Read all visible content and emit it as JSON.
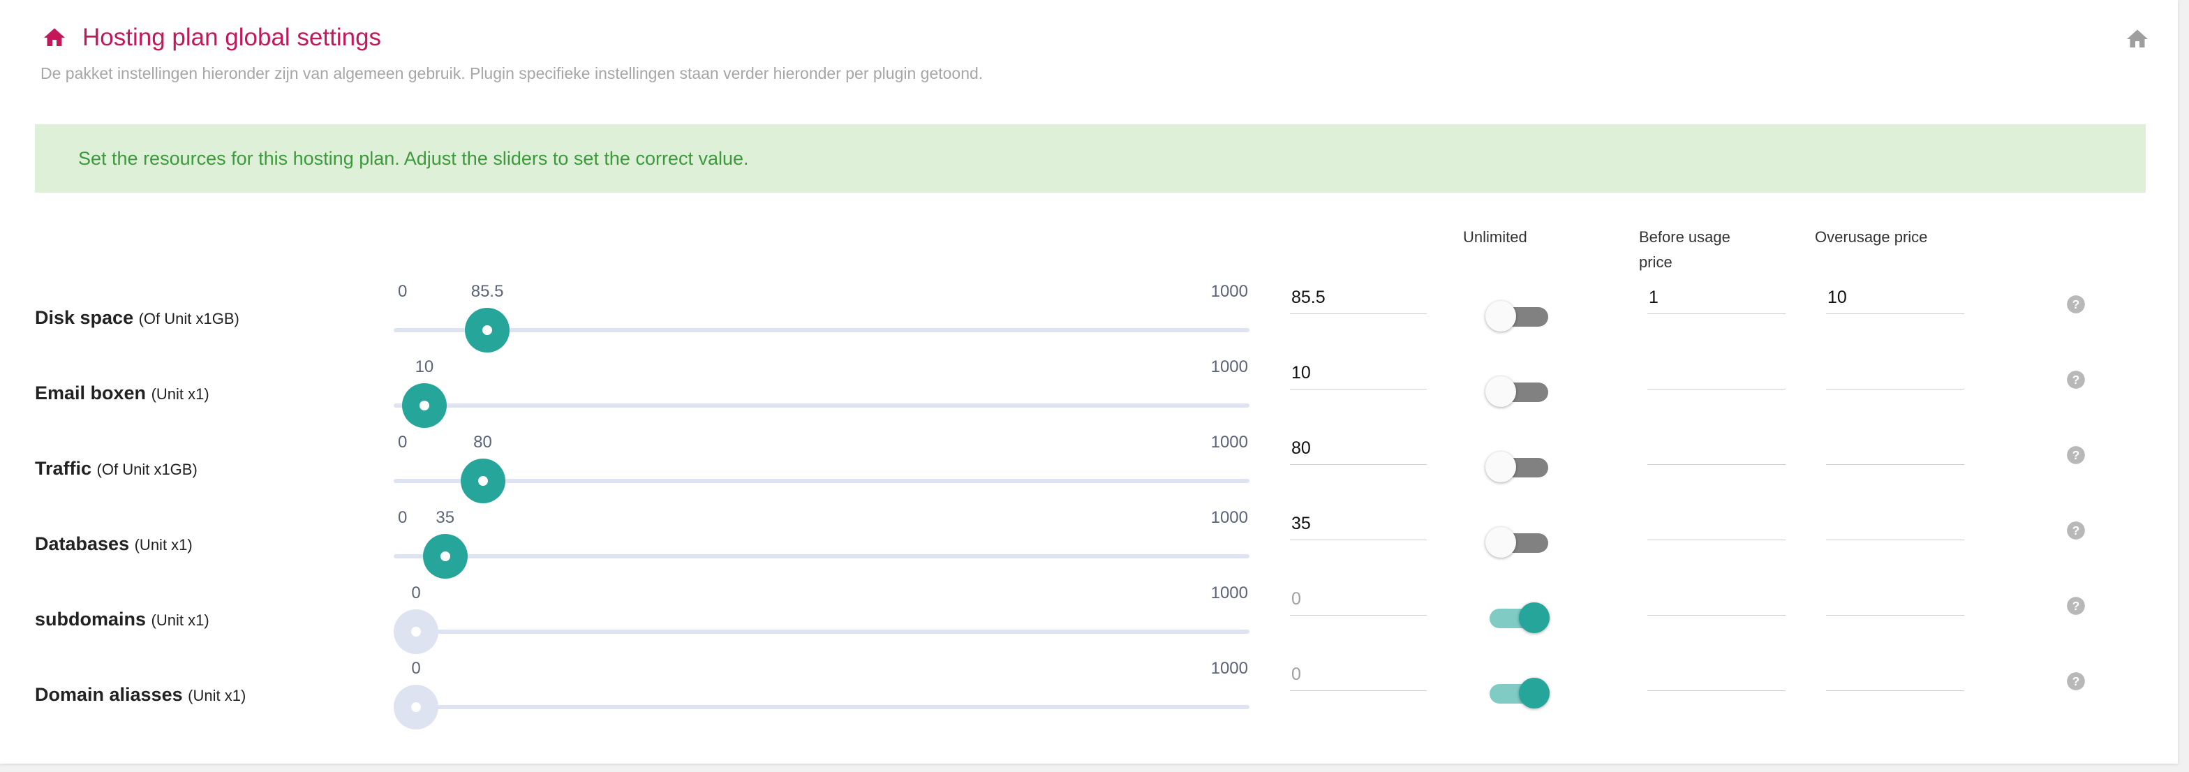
{
  "header": {
    "title": "Hosting plan global settings",
    "subtitle": "De pakket instellingen hieronder zijn van algemeen gebruik. Plugin specifieke instellingen staan verder hieronder per plugin getoond.",
    "title_icon": "home-icon",
    "right_icon": "home-icon"
  },
  "alert": {
    "text": "Set the resources for this hosting plan. Adjust the sliders to set the correct value."
  },
  "columns": {
    "unlimited": "Unlimited",
    "before_usage_price": "Before usage price",
    "overusage_price": "Overusage price"
  },
  "colors": {
    "title": "#c2185b",
    "accent": "#26a69a",
    "alert_bg": "#dff0d8",
    "alert_text": "#3c9a3c"
  },
  "resources": [
    {
      "name": "Disk space",
      "unit": "(Of Unit x1GB)",
      "slider": {
        "min": 0,
        "max": 1000,
        "min_label": "0",
        "max_label": "1000",
        "value": 85.5,
        "value_label": "85.5",
        "show_min": true,
        "active": true
      },
      "value_field": "85.5",
      "unlimited": false,
      "before_usage_price": "1",
      "overusage_price": "10"
    },
    {
      "name": "Email boxen",
      "unit": "(Unit x1)",
      "slider": {
        "min": 0,
        "max": 1000,
        "min_label": "",
        "max_label": "1000",
        "value": 10,
        "value_label": "10",
        "show_min": false,
        "active": true
      },
      "value_field": "10",
      "unlimited": false,
      "before_usage_price": "",
      "overusage_price": ""
    },
    {
      "name": "Traffic",
      "unit": "(Of Unit x1GB)",
      "slider": {
        "min": 0,
        "max": 1000,
        "min_label": "0",
        "max_label": "1000",
        "value": 80,
        "value_label": "80",
        "show_min": true,
        "active": true
      },
      "value_field": "80",
      "unlimited": false,
      "before_usage_price": "",
      "overusage_price": ""
    },
    {
      "name": "Databases",
      "unit": "(Unit x1)",
      "slider": {
        "min": 0,
        "max": 1000,
        "min_label": "0",
        "max_label": "1000",
        "value": 35,
        "value_label": "35",
        "show_min": true,
        "active": true
      },
      "value_field": "35",
      "unlimited": false,
      "before_usage_price": "",
      "overusage_price": ""
    },
    {
      "name": "subdomains",
      "unit": "(Unit x1)",
      "slider": {
        "min": 0,
        "max": 1000,
        "min_label": "",
        "max_label": "1000",
        "value": 0,
        "value_label": "0",
        "show_min": false,
        "active": false
      },
      "value_field": "0",
      "unlimited": true,
      "before_usage_price": "",
      "overusage_price": ""
    },
    {
      "name": "Domain aliasses",
      "unit": "(Unit x1)",
      "slider": {
        "min": 0,
        "max": 1000,
        "min_label": "",
        "max_label": "1000",
        "value": 0,
        "value_label": "0",
        "show_min": false,
        "active": false
      },
      "value_field": "0",
      "unlimited": true,
      "before_usage_price": "",
      "overusage_price": ""
    }
  ]
}
